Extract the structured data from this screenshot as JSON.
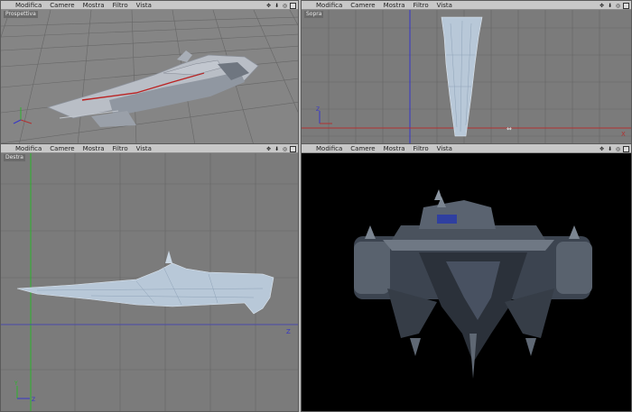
{
  "viewports": {
    "perspective": {
      "menu": [
        "Modifica",
        "Camere",
        "Mostra",
        "Filtro",
        "Vista"
      ],
      "label": "Prospettiva"
    },
    "top": {
      "menu": [
        "Modifica",
        "Camere",
        "Mostra",
        "Filtro",
        "Vista"
      ],
      "label": "Sopra"
    },
    "right": {
      "menu": [
        "Modifica",
        "Camere",
        "Mostra",
        "Filtro",
        "Vista"
      ],
      "label": "Destra"
    },
    "front": {
      "menu": [
        "Modifica",
        "Camere",
        "Mostra",
        "Filtro",
        "Vista"
      ]
    }
  },
  "controls": {
    "move_icon": "✥",
    "down_icon": "⬇",
    "zoom_icon": "◎"
  },
  "axes": {
    "x": "X",
    "y": "Y",
    "z": "Z"
  },
  "colors": {
    "viewport_bg": "#7a7a7a",
    "grid": "#5f5f5f",
    "x_axis": "#b23030",
    "y_axis": "#2bb52b",
    "z_axis": "#3535c8",
    "wire": "#b8c8d8",
    "render_bg": "#000000"
  }
}
